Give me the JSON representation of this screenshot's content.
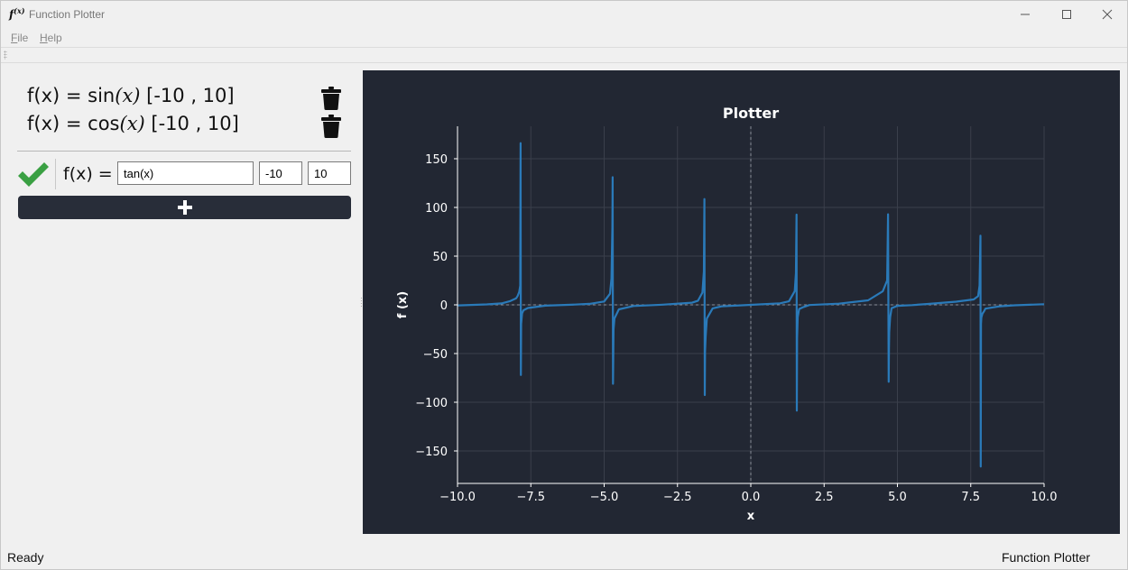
{
  "window": {
    "app_icon_text": "f",
    "app_icon_sup": "(x)",
    "title": "Function Plotter"
  },
  "menu": {
    "items": [
      {
        "mnemonic": "F",
        "rest": "ile"
      },
      {
        "mnemonic": "H",
        "rest": "elp"
      }
    ]
  },
  "functions": [
    {
      "prefix": "f(x) = ",
      "fn": "sin",
      "arg": "(x)",
      "range": " [-10 , 10]"
    },
    {
      "prefix": "f(x) = ",
      "fn": "cos",
      "arg": "(x)",
      "range": " [-10 , 10]"
    }
  ],
  "editor": {
    "label": "f(x) =",
    "expression": "tan(x)",
    "min": "-10",
    "max": "10"
  },
  "colors": {
    "plot_bg": "#222733",
    "line": "#2a7ab9",
    "check": "#3aa043",
    "button_bg": "#282d39"
  },
  "chart_data": {
    "type": "line",
    "title": "Plotter",
    "xlabel": "x",
    "ylabel": "f (x)",
    "function": "tan(x)",
    "xlim": [
      -10,
      10
    ],
    "ylim": [
      -180,
      180
    ],
    "xticks": [
      "−10.0",
      "−7.5",
      "−5.0",
      "−2.5",
      "0.0",
      "2.5",
      "5.0",
      "7.5",
      "10.0"
    ],
    "yticks": [
      "150",
      "100",
      "50",
      "0",
      "−50",
      "−100",
      "−150"
    ],
    "xtick_values": [
      -10,
      -7.5,
      -5,
      -2.5,
      0,
      2.5,
      5,
      7.5,
      10
    ],
    "ytick_values": [
      150,
      100,
      50,
      0,
      -50,
      -100,
      -150
    ],
    "grid": true,
    "series": [
      {
        "x": [
          -10,
          -9,
          -8.5,
          -8.2,
          -8,
          -7.95,
          -7.9,
          -7.86,
          -7.85,
          -7.84,
          -7.83,
          -7.8,
          -7.75,
          -7.6,
          -7,
          -6,
          -5.5,
          -5,
          -4.8,
          -4.75,
          -4.72,
          -4.71,
          -4.7,
          -4.68,
          -4.65,
          -4.5,
          -4,
          -3,
          -2,
          -1.8,
          -1.65,
          -1.6,
          -1.58,
          -1.57,
          -1.56,
          -1.54,
          -1.5,
          -1.3,
          -1,
          0,
          1,
          1.3,
          1.5,
          1.54,
          1.56,
          1.57,
          1.58,
          1.6,
          1.65,
          1.8,
          2,
          3,
          4,
          4.5,
          4.65,
          4.68,
          4.7,
          4.71,
          4.72,
          4.75,
          4.8,
          5,
          5.5,
          6,
          7,
          7.6,
          7.75,
          7.8,
          7.83,
          7.84,
          7.85,
          7.86,
          7.9,
          7.95,
          8,
          8.5,
          9,
          10
        ],
        "y": [
          -0.65,
          0.45,
          1.5,
          3.9,
          6.8,
          9.1,
          13.1,
          19.6,
          166.0,
          -72.0,
          -19.7,
          -8.9,
          -5.6,
          -3.2,
          -0.87,
          0.29,
          0.99,
          3.4,
          11.4,
          27.0,
          80.0,
          131.0,
          -81.0,
          -25.0,
          -14.0,
          -4.6,
          -1.16,
          0.14,
          2.19,
          4.29,
          12.6,
          34.2,
          108.6,
          -92.6,
          -48.1,
          -32.5,
          -14.1,
          -3.6,
          -1.56,
          0,
          1.56,
          3.6,
          14.1,
          32.5,
          92.6,
          -108.6,
          -34.2,
          -12.6,
          -4.29,
          -2.19,
          -0.14,
          1.16,
          4.6,
          14.0,
          25.0,
          93.0,
          -79.0,
          -45.0,
          -28.0,
          -13.0,
          -3.4,
          -0.99,
          -0.29,
          0.87,
          3.2,
          5.6,
          8.9,
          19.7,
          71.0,
          -166.0,
          -19.6,
          -13.1,
          -9.1,
          -6.8,
          -3.9,
          -1.5,
          -0.45,
          0.65
        ]
      }
    ]
  },
  "status": {
    "left": "Ready",
    "right": "Function Plotter"
  }
}
